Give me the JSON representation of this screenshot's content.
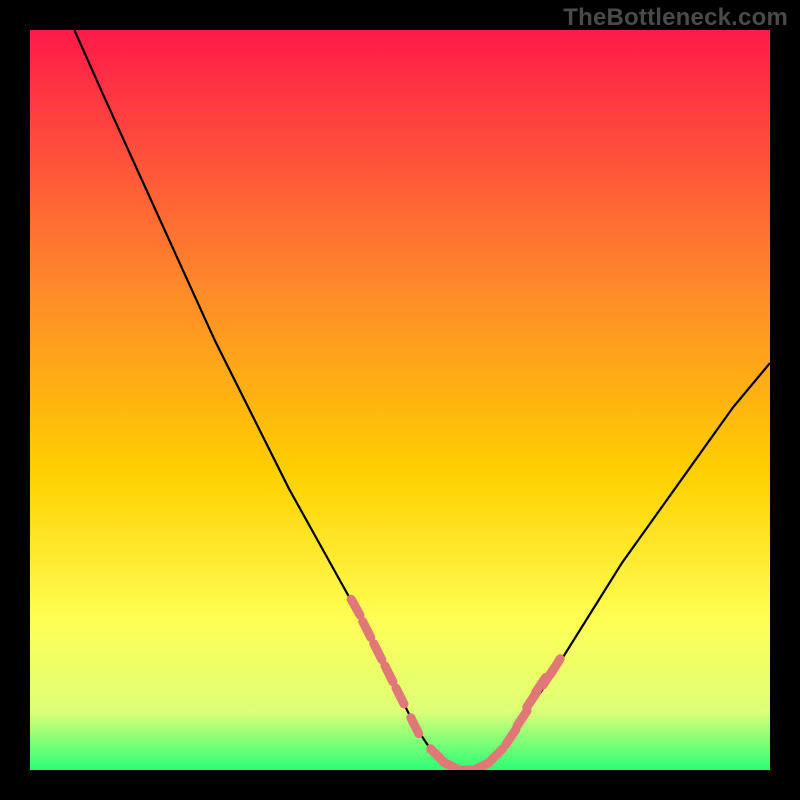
{
  "watermark": "TheBottleneck.com",
  "colors": {
    "background": "#000000",
    "gradient_top": "#ff1a4a",
    "gradient_mid1": "#ff6a2a",
    "gradient_mid2": "#ffd000",
    "gradient_mid3": "#ffff55",
    "gradient_mid4": "#ddff77",
    "gradient_bottom": "#2aff77",
    "curve": "#000000",
    "marker_fill": "#e07878",
    "marker_stroke": "#c96060"
  },
  "chart_data": {
    "type": "line",
    "title": "",
    "xlabel": "",
    "ylabel": "",
    "xlim": [
      0,
      100
    ],
    "ylim": [
      0,
      100
    ],
    "series": [
      {
        "name": "bottleneck-curve",
        "x": [
          6,
          10,
          15,
          20,
          25,
          30,
          35,
          40,
          45,
          48,
          50,
          52,
          54,
          56,
          58,
          60,
          62,
          64,
          66,
          70,
          75,
          80,
          85,
          90,
          95,
          100
        ],
        "y": [
          100,
          91,
          80,
          69,
          58,
          48,
          38,
          29,
          20,
          14,
          10,
          6,
          3,
          1,
          0,
          0,
          1,
          3,
          6,
          12,
          20,
          28,
          35,
          42,
          49,
          55
        ]
      }
    ],
    "markers": {
      "name": "highlight-points",
      "x": [
        44,
        45.5,
        47,
        48.5,
        50,
        52,
        55,
        57,
        59,
        61,
        63,
        65,
        66.5,
        67.8,
        69,
        70,
        71
      ],
      "y": [
        22,
        19,
        16,
        13,
        10,
        6,
        2,
        0.5,
        0,
        0.5,
        2,
        4.5,
        7,
        9.5,
        11.5,
        12.5,
        14
      ]
    }
  }
}
